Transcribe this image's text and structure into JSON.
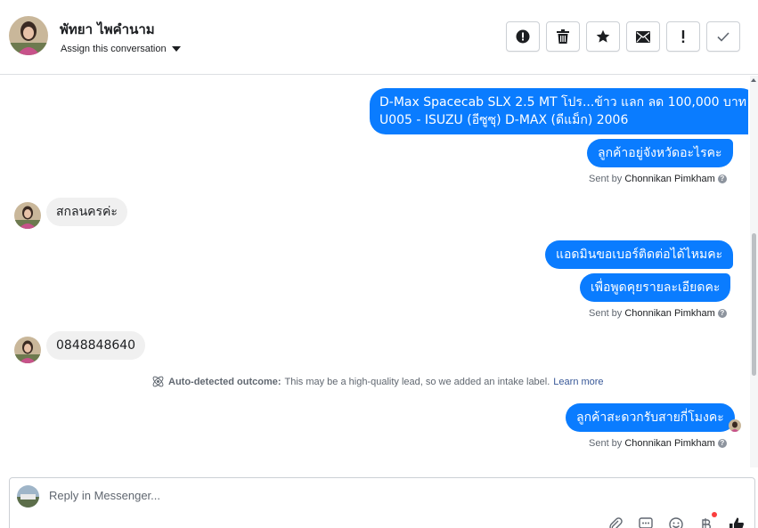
{
  "header": {
    "contact_name": "พัทยา ไพคำนาม",
    "assign_label": "Assign this conversation",
    "actions": [
      {
        "name": "spam-button",
        "icon": "alert-circle-icon"
      },
      {
        "name": "delete-button",
        "icon": "trash-icon"
      },
      {
        "name": "star-button",
        "icon": "star-icon"
      },
      {
        "name": "mark-unread-button",
        "icon": "envelope-icon"
      },
      {
        "name": "follow-up-button",
        "icon": "exclamation-icon"
      },
      {
        "name": "mark-done-button",
        "icon": "checkmark-icon"
      }
    ]
  },
  "messages": {
    "out1_line1": "D-Max Spacecab SLX 2.5 MT โปร...ข้าว แลก ลด 100,000 บาท",
    "out1_line2": "U005 - ISUZU (อีซูซุ) D-MAX (ดีแม็ก) 2006",
    "out2": "ลูกค้าอยู่จังหวัดอะไรคะ",
    "sent_prefix": "Sent by",
    "sender": "Chonnikan Pimkham",
    "in1": "สกลนครค่ะ",
    "out3": "แอดมินขอเบอร์ติดต่อได้ไหมคะ",
    "out4": "เพื่อพูดคุยรายละเอียดคะ",
    "in2": "0848848640",
    "outcome_label": "Auto-detected outcome:",
    "outcome_text": "This may be a high-quality lead, so we added an intake label.",
    "outcome_link": "Learn more",
    "out5": "ลูกค้าสะดวกรับสายกี่โมงคะ"
  },
  "composer": {
    "placeholder": "Reply in Messenger..."
  },
  "colors": {
    "outgoing_bubble": "#0a7cff",
    "incoming_bubble": "#f0f0f0",
    "link": "#385898"
  }
}
